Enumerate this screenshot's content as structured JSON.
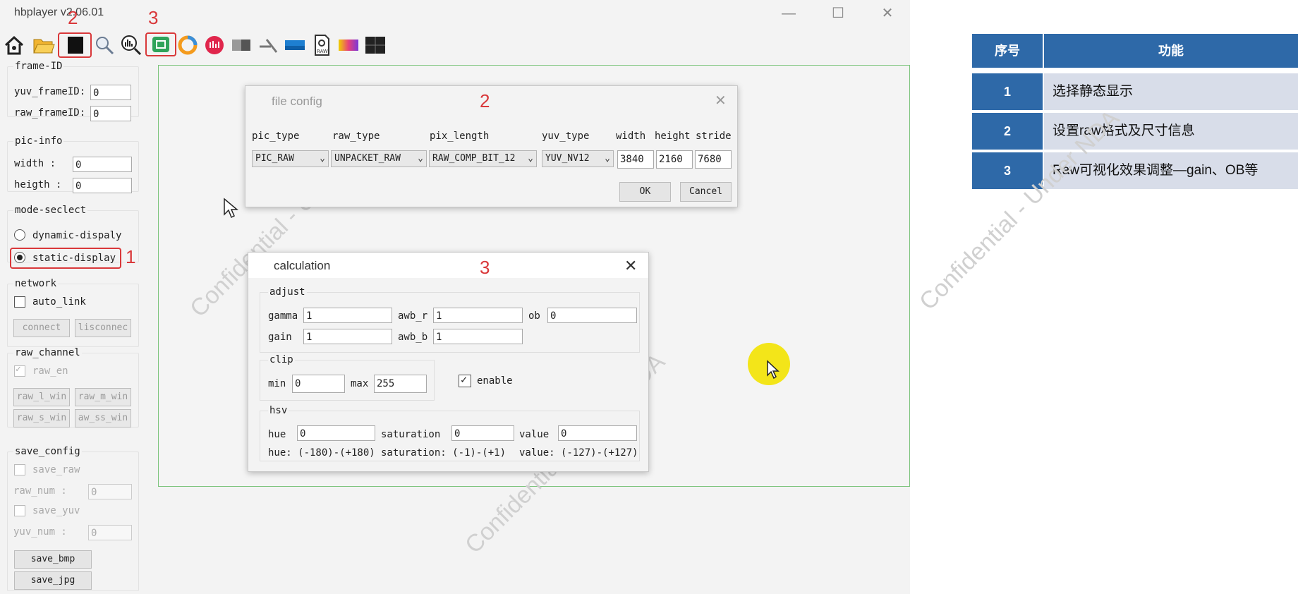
{
  "window": {
    "title": "hbplayer v2.06.01",
    "controls": {
      "minimize": "—",
      "maximize": "☐",
      "close": "✕"
    }
  },
  "toolbar": {
    "icons": [
      "home-icon",
      "open-folder-icon",
      "image-icon",
      "zoom-icon",
      "histogram-icon",
      "calculation-icon",
      "color-wheel-icon",
      "record-icon",
      "grayscale-icon",
      "tools-icon",
      "panorama-icon",
      "raw-file-icon",
      "spectrum-icon",
      "grid-icon"
    ],
    "marker_2": "2",
    "marker_3": "3"
  },
  "left_panel": {
    "frame_id": {
      "title": "frame-ID",
      "yuv_label": "yuv_frameID:",
      "yuv_value": "0",
      "raw_label": "raw_frameID:",
      "raw_value": "0"
    },
    "pic_info": {
      "title": "pic-info",
      "width_label": "width :",
      "width_value": "0",
      "height_label": "heigth :",
      "height_value": "0"
    },
    "mode_select": {
      "title": "mode-seclect",
      "dynamic_label": "dynamic-dispaly",
      "static_label": "static-display",
      "selected": "static-display",
      "marker": "1"
    },
    "network": {
      "title": "network",
      "auto_link_label": "auto_link",
      "connect_label": "connect",
      "disconnect_label": "lisconnec"
    },
    "raw_channel": {
      "title": "raw_channel",
      "raw_en_label": "raw_en",
      "buttons": [
        "raw_l_win",
        "raw_m_win",
        "raw_s_win",
        "aw_ss_win"
      ]
    },
    "save_config": {
      "title": "save_config",
      "save_raw_label": "save_raw",
      "raw_num_label": "raw_num :",
      "raw_num_value": "0",
      "save_yuv_label": "save_yuv",
      "yuv_num_label": "yuv_num :",
      "yuv_num_value": "0",
      "save_bmp_label": "save_bmp",
      "save_jpg_label": "save_jpg"
    }
  },
  "watermark": "Confidential - Under NDA",
  "file_config": {
    "title": "file config",
    "marker": "2",
    "headers": {
      "pic_type": "pic_type",
      "raw_type": "raw_type",
      "pix_length": "pix_length",
      "yuv_type": "yuv_type",
      "width": "width",
      "height": "height",
      "stride": "stride"
    },
    "values": {
      "pic_type": "PIC_RAW",
      "raw_type": "UNPACKET_RAW",
      "pix_length": "RAW_COMP_BIT_12",
      "yuv_type": "YUV_NV12",
      "width": "3840",
      "height": "2160",
      "stride": "7680"
    },
    "ok": "OK",
    "cancel": "Cancel"
  },
  "calculation": {
    "title": "calculation",
    "marker": "3",
    "adjust": {
      "title": "adjust",
      "gamma_label": "gamma",
      "gamma": "1",
      "awb_r_label": "awb_r",
      "awb_r": "1",
      "ob_label": "ob",
      "ob": "0",
      "gain_label": "gain",
      "gain": "1",
      "awb_b_label": "awb_b",
      "awb_b": "1"
    },
    "clip": {
      "title": "clip",
      "min_label": "min",
      "min": "0",
      "max_label": "max",
      "max": "255",
      "enable_label": "enable",
      "enable_checked": true
    },
    "hsv": {
      "title": "hsv",
      "hue_label": "hue",
      "hue": "0",
      "saturation_label": "saturation",
      "saturation": "0",
      "value_label": "value",
      "value": "0",
      "hue_range": "hue: (-180)-(+180)",
      "saturation_range": "saturation: (-1)-(+1)",
      "value_range": "value: (-127)-(+127)"
    }
  },
  "legend_table": {
    "headers": [
      "序号",
      "功能"
    ],
    "rows": [
      {
        "no": "1",
        "function": "选择静态显示"
      },
      {
        "no": "2",
        "function": "设置raw格式及尺寸信息"
      },
      {
        "no": "3",
        "function": "Raw可视化效果调整—gain、OB等"
      }
    ]
  },
  "colors": {
    "accent_red": "#d9383a",
    "table_blue": "#2e69a8",
    "table_cell": "#d8dde9",
    "canvas_border": "#7cc47c",
    "cursor_highlight": "#f3e519"
  }
}
